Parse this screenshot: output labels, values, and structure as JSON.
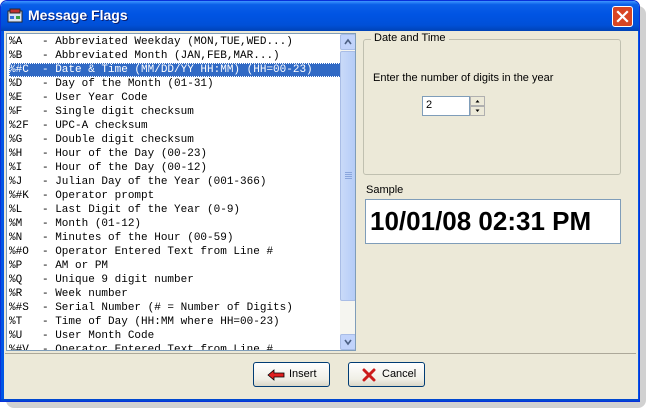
{
  "window": {
    "title": "Message Flags"
  },
  "flags_list": {
    "items": [
      "%A   - Abbreviated Weekday (MON,TUE,WED...)",
      "%B   - Abbreviated Month (JAN,FEB,MAR...)",
      "%#C  - Date & Time (MM/DD/YY HH:MM) (HH=00-23)",
      "%D   - Day of the Month (01-31)",
      "%E   - User Year Code",
      "%F   - Single digit checksum",
      "%2F  - UPC-A checksum",
      "%G   - Double digit checksum",
      "%H   - Hour of the Day (00-23)",
      "%I   - Hour of the Day (00-12)",
      "%J   - Julian Day of the Year (001-366)",
      "%#K  - Operator prompt",
      "%L   - Last Digit of the Year (0-9)",
      "%M   - Month (01-12)",
      "%N   - Minutes of the Hour (00-59)",
      "%#O  - Operator Entered Text from Line #",
      "%P   - AM or PM",
      "%Q   - Unique 9 digit number",
      "%R   - Week number",
      "%#S  - Serial Number (# = Number of Digits)",
      "%T   - Time of Day (HH:MM where HH=00-23)",
      "%U   - User Month Code",
      "%#V  - Operator Entered Text from Line #"
    ],
    "selected_index": 2
  },
  "date_time": {
    "legend": "Date and Time",
    "prompt": "Enter the number of digits in the year",
    "digits_value": "2"
  },
  "sample": {
    "label": "Sample",
    "text": "10/01/08 02:31 PM"
  },
  "buttons": {
    "insert": "Insert",
    "cancel": "Cancel"
  },
  "colors": {
    "titlebar": "#0054e3",
    "selection": "#316ac5",
    "close": "#d84523"
  }
}
